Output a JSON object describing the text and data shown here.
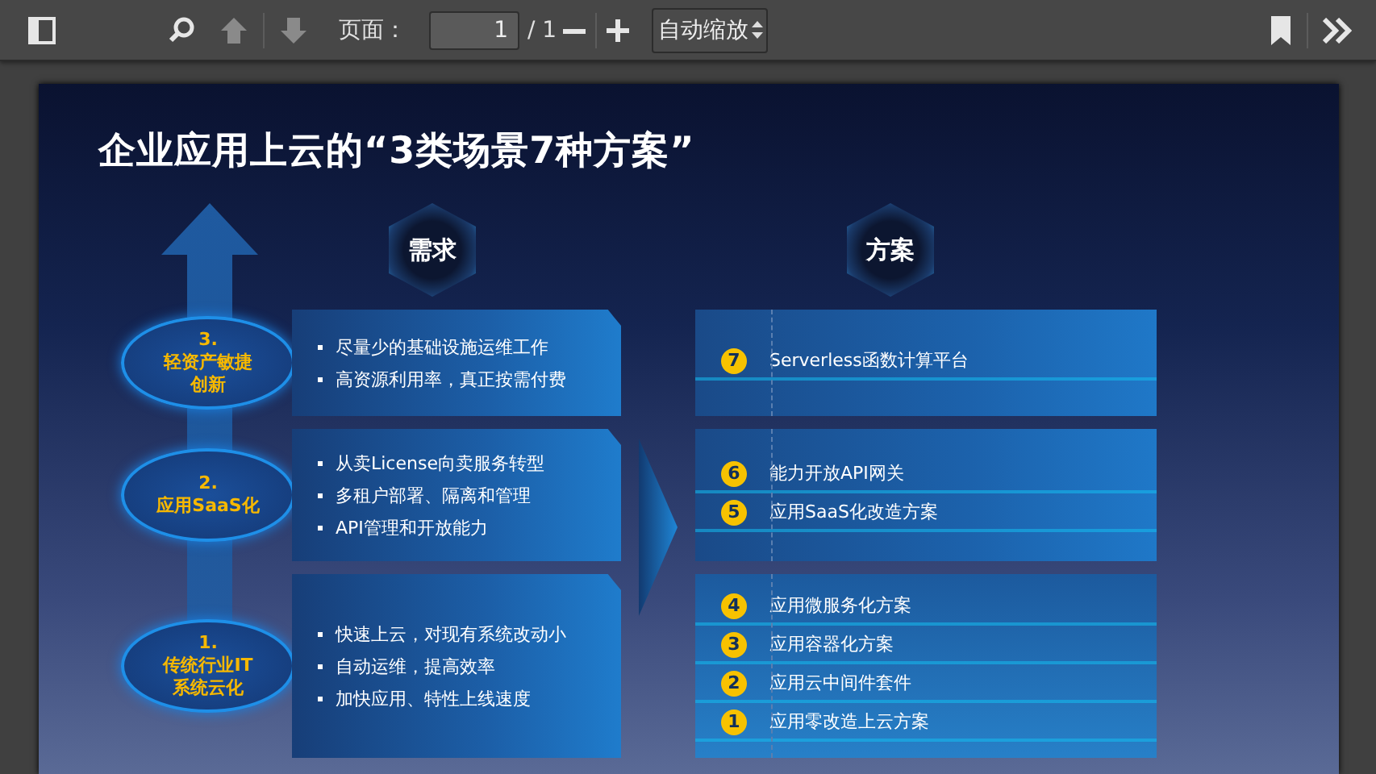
{
  "toolbar": {
    "page_label": "页面：",
    "page_value": "1",
    "page_total": "/ 1",
    "zoom_select": "自动缩放",
    "previous_page": {
      "disabled": true
    },
    "next_page": {
      "disabled": true
    }
  },
  "slide": {
    "title": "企业应用上云的“3类场景7种方案”",
    "needs_header": "需求",
    "solutions_header": "方案",
    "scenarios": [
      {
        "number": "3.",
        "name": "轻资产敏捷创新",
        "bullets": [
          "尽量少的基础设施运维工作",
          "高资源利用率，真正按需付费"
        ]
      },
      {
        "number": "2.",
        "name": "应用SaaS化",
        "bullets": [
          "从卖License向卖服务转型",
          "多租户部署、隔离和管理",
          "API管理和开放能力"
        ]
      },
      {
        "number": "1.",
        "name": "传统行业IT系统云化",
        "bullets": [
          "快速上云，对现有系统改动小",
          "自动运维，提高效率",
          "加快应用、特性上线速度"
        ]
      }
    ],
    "solution_groups": [
      {
        "items": [
          {
            "number": "7",
            "text": "Serverless函数计算平台"
          }
        ]
      },
      {
        "items": [
          {
            "number": "6",
            "text": "能力开放API网关"
          },
          {
            "number": "5",
            "text": "应用SaaS化改造方案"
          }
        ]
      },
      {
        "items": [
          {
            "number": "4",
            "text": "应用微服务化方案"
          },
          {
            "number": "3",
            "text": "应用容器化方案"
          },
          {
            "number": "2",
            "text": "应用云中间件套件"
          },
          {
            "number": "1",
            "text": "应用零改造上云方案"
          }
        ]
      }
    ]
  }
}
